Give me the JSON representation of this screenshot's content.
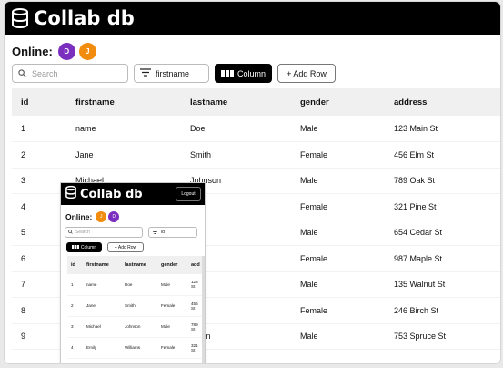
{
  "app": {
    "title": "Collab db",
    "icon": "database-icon"
  },
  "online": {
    "label": "Online:",
    "users": [
      {
        "initial": "D",
        "color": "#7b2fbe"
      },
      {
        "initial": "J",
        "color": "#f28c0f"
      }
    ]
  },
  "toolbar": {
    "search_placeholder": "Search",
    "filter_value": "firstname",
    "column_button": "Column",
    "add_row_button": "+ Add Row"
  },
  "table": {
    "columns": [
      "id",
      "firstname",
      "lastname",
      "gender",
      "address"
    ],
    "rows": [
      [
        "1",
        "name",
        "Doe",
        "Male",
        "123 Main St"
      ],
      [
        "2",
        "Jane",
        "Smith",
        "Female",
        "456 Elm St"
      ],
      [
        "3",
        "Michael",
        "Johnson",
        "Male",
        "789 Oak St"
      ],
      [
        "4",
        "",
        "ams",
        "Female",
        "321 Pine St"
      ],
      [
        "5",
        "",
        "vn",
        "Male",
        "654 Cedar St"
      ],
      [
        "6",
        "",
        "es",
        "Female",
        "987 Maple St"
      ],
      [
        "7",
        "",
        "s",
        "Male",
        "135 Walnut St"
      ],
      [
        "8",
        "",
        "er",
        "Female",
        "246 Birch St"
      ],
      [
        "9",
        "",
        "erson",
        "Male",
        "753 Spruce St"
      ]
    ]
  },
  "inset": {
    "title": "Collab db",
    "logout": "Logout",
    "online_label": "Online:",
    "users": [
      {
        "initial": "J",
        "color": "#f28c0f"
      },
      {
        "initial": "D",
        "color": "#7b2fbe"
      }
    ],
    "search_placeholder": "Search",
    "filter_value": "id",
    "column_button": "Column",
    "add_row_button": "+ Add Row",
    "columns": [
      "id",
      "firstname",
      "lastname",
      "gender",
      "add"
    ],
    "rows": [
      [
        "1",
        "name",
        "Doe",
        "Male",
        "123\nSt"
      ],
      [
        "2",
        "Jane",
        "Smith",
        "Female",
        "456\nSt"
      ],
      [
        "3",
        "Michael",
        "Johnson",
        "Male",
        "789\nSt"
      ],
      [
        "4",
        "Emily",
        "Williams",
        "Female",
        "321\nSt"
      ]
    ]
  }
}
